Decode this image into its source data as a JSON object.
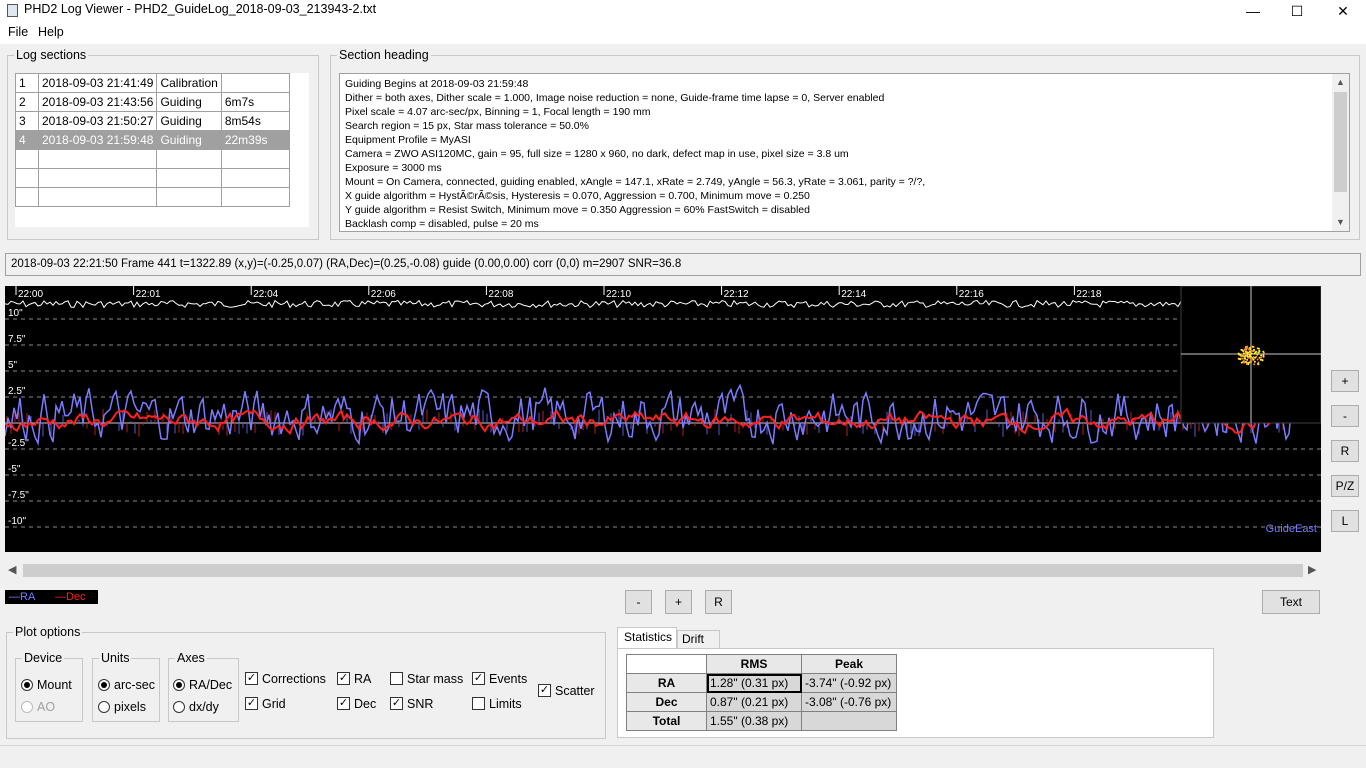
{
  "window": {
    "title": "PHD2 Log Viewer - PHD2_GuideLog_2018-09-03_213943-2.txt",
    "min_glyph": "—",
    "max_glyph": "☐",
    "close_glyph": "✕"
  },
  "menu": {
    "file": "File",
    "help": "Help"
  },
  "log_sections": {
    "title": "Log sections",
    "rows": [
      {
        "num": "1",
        "time": "2018-09-03 21:41:49",
        "type": "Calibration",
        "dur": ""
      },
      {
        "num": "2",
        "time": "2018-09-03 21:43:56",
        "type": "Guiding",
        "dur": "6m7s"
      },
      {
        "num": "3",
        "time": "2018-09-03 21:50:27",
        "type": "Guiding",
        "dur": "8m54s"
      },
      {
        "num": "4",
        "time": "2018-09-03 21:59:48",
        "type": "Guiding",
        "dur": "22m39s"
      }
    ]
  },
  "section_heading": {
    "title": "Section heading",
    "lines": [
      "Guiding Begins at 2018-09-03 21:59:48",
      "Dither = both axes, Dither scale = 1.000, Image noise reduction = none, Guide-frame time lapse = 0, Server enabled",
      "Pixel scale = 4.07 arc-sec/px, Binning = 1, Focal length = 190 mm",
      "Search region = 15 px, Star mass tolerance = 50.0%",
      "Equipment Profile = MyASI",
      "Camera = ZWO ASI120MC, gain = 95, full size = 1280 x 960, no dark, defect map in use, pixel size = 3.8 um",
      "Exposure = 3000 ms",
      "Mount = On Camera,  connected, guiding enabled, xAngle = 147.1, xRate = 2.749, yAngle = 56.3, yRate = 3.061, parity = ?/?,",
      "X guide algorithm = HystÃ©rÃ©sis, Hysteresis = 0.070, Aggression = 0.700, Minimum move = 0.250",
      "Y guide algorithm = Resist Switch, Minimum move = 0.350 Aggression = 60% FastSwitch = disabled",
      "Backlash comp = disabled, pulse = 20 ms"
    ]
  },
  "status_line": "2018-09-03 22:21:50 Frame 441 t=1322.89 (x,y)=(-0.25,0.07) (RA,Dec)=(0.25,-0.08) guide (0.00,0.00) corr (0,0) m=2907 SNR=36.8",
  "chart_data": {
    "type": "line",
    "time_ticks": [
      "22:00",
      "22:01",
      "22:04",
      "22:06",
      "22:08",
      "22:10",
      "22:12",
      "22:14",
      "22:16",
      "22:18"
    ],
    "y_ticks": [
      "10\"",
      "7.5\"",
      "5\"",
      "2.5\"",
      "-2.5\"",
      "-5\"",
      "-7.5\"",
      "-10\""
    ],
    "y_tick_values": [
      10,
      7.5,
      5,
      2.5,
      -2.5,
      -5,
      -7.5,
      -10
    ],
    "ylim": [
      -11.5,
      11.5
    ],
    "xlim": [
      0,
      1
    ],
    "series": [
      {
        "name": "RA",
        "color": "#7b7bff"
      },
      {
        "name": "Dec",
        "color": "#ff2020"
      }
    ],
    "corner_label": "GuideEast",
    "grid": true
  },
  "plot_buttons": {
    "plus": "+",
    "minus": "-",
    "r": "R",
    "pz": "P/Z",
    "l": "L"
  },
  "legend": {
    "ra": "—RA",
    "dec": "—Dec"
  },
  "bottom_buttons": {
    "minus": "-",
    "plus": "+",
    "r": "R",
    "text": "Text"
  },
  "plot_options": {
    "title": "Plot options",
    "device": {
      "title": "Device",
      "mount": "Mount",
      "ao": "AO"
    },
    "units": {
      "title": "Units",
      "arcsec": "arc-sec",
      "pixels": "pixels"
    },
    "axes": {
      "title": "Axes",
      "radec": "RA/Dec",
      "dxdy": "dx/dy"
    },
    "checks": {
      "corrections": "Corrections",
      "grid": "Grid",
      "ra": "RA",
      "dec": "Dec",
      "star_mass": "Star mass",
      "snr": "SNR",
      "events": "Events",
      "limits": "Limits",
      "scatter": "Scatter"
    }
  },
  "stats": {
    "tab_statistics": "Statistics",
    "tab_drift": "Drift",
    "col_rms": "RMS",
    "col_peak": "Peak",
    "rows": [
      {
        "label": "RA",
        "rms": "1.28\" (0.31 px)",
        "peak": "-3.74\" (-0.92 px)"
      },
      {
        "label": "Dec",
        "rms": "0.87\" (0.21 px)",
        "peak": "-3.08\" (-0.76 px)"
      },
      {
        "label": "Total",
        "rms": "1.55\" (0.38 px)",
        "peak": ""
      }
    ]
  }
}
